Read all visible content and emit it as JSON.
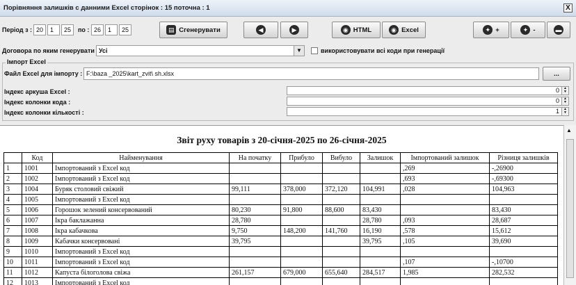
{
  "window": {
    "title": "Порівняння залишків с данними Excel   сторінок : 15  поточна : 1",
    "close": "X"
  },
  "period": {
    "label_from": "Період з :",
    "from": {
      "day": "20",
      "month": "1",
      "year": "25"
    },
    "label_to": "по :",
    "to": {
      "day": "26",
      "month": "1",
      "year": "25"
    }
  },
  "toolbar": {
    "generate": "Сгенерувати",
    "html": "HTML",
    "excel": "Excel",
    "add_suffix": "+",
    "remove_suffix": "-"
  },
  "codes": {
    "label": "Договора по яким генерувати :",
    "selected": "Усі",
    "use_all_label": "використовувати всі коди при генерації"
  },
  "import": {
    "section_title": "Імпорт Excel",
    "file_label": "Файл Excel для імпорту :",
    "file_path": "F:\\baza          _2025\\kart_zvit\\              sh.xlsx",
    "browse": "...",
    "sheet_label": "Індекс аркуша Excel :",
    "sheet_value": "0",
    "code_col_label": "Індекс колонки кода :",
    "code_col_value": "0",
    "qty_col_label": "Індекс колонки кількості :",
    "qty_col_value": "1"
  },
  "report": {
    "title": "Звіт руху товарів з 20-січня-2025 по 26-січня-2025",
    "headers": [
      "",
      "Код",
      "Найменування",
      "На початку",
      "Прибуло",
      "Вибуло",
      "Залишок",
      "Імпортований залишок",
      "Різниця залишків"
    ],
    "rows": [
      [
        "1",
        "1001",
        "Імпортований з Excel код",
        "",
        "",
        "",
        "",
        ",269",
        "-,26900"
      ],
      [
        "2",
        "1002",
        "Імпортований з Excel код",
        "",
        "",
        "",
        "",
        ",693",
        "-,69300"
      ],
      [
        "3",
        "1004",
        "Буряк столовий свіжий",
        "99,111",
        "378,000",
        "372,120",
        "104,991",
        ",028",
        "104,963"
      ],
      [
        "4",
        "1005",
        "Імпортований з Excel код",
        "",
        "",
        "",
        "",
        "",
        ""
      ],
      [
        "5",
        "1006",
        "Горошок зелений консервований",
        "80,230",
        "91,800",
        "88,600",
        "83,430",
        "",
        "83,430"
      ],
      [
        "6",
        "1007",
        "Ікра баклажанна",
        "28,780",
        "",
        "",
        "28,780",
        ",093",
        "28,687"
      ],
      [
        "7",
        "1008",
        "Ікра кабачкова",
        "9,750",
        "148,200",
        "141,760",
        "16,190",
        ",578",
        "15,612"
      ],
      [
        "8",
        "1009",
        "Кабачки консервовані",
        "39,795",
        "",
        "",
        "39,795",
        ",105",
        "39,690"
      ],
      [
        "9",
        "1010",
        "Імпортований з Excel код",
        "",
        "",
        "",
        "",
        "",
        ""
      ],
      [
        "10",
        "1011",
        "Імпортований з Excel код",
        "",
        "",
        "",
        "",
        ",107",
        "-,10700"
      ],
      [
        "11",
        "1012",
        "Капуста білоголова свіжа",
        "261,157",
        "679,000",
        "655,640",
        "284,517",
        "1,985",
        "282,532"
      ],
      [
        "12",
        "1013",
        "Імпортований з Excel код",
        "",
        "",
        "",
        "",
        "",
        ""
      ]
    ]
  }
}
